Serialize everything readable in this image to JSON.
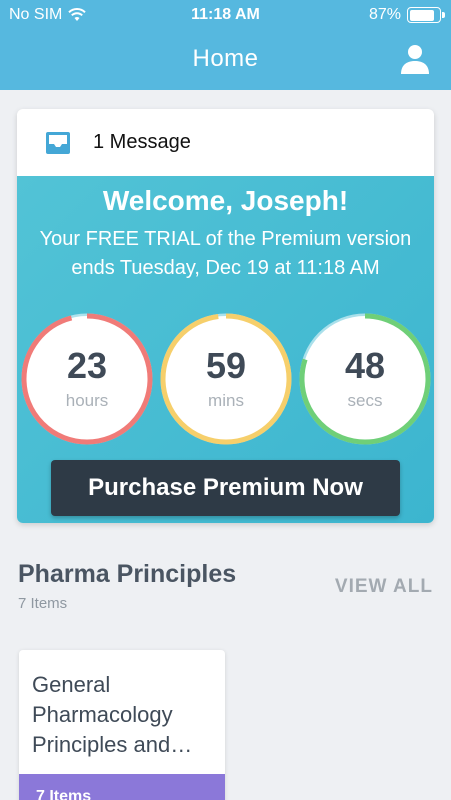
{
  "status": {
    "carrier": "No SIM",
    "time": "11:18 AM",
    "battery": "87%",
    "battery_level": 0.87
  },
  "nav": {
    "title": "Home"
  },
  "message": {
    "label": "1 Message"
  },
  "promo": {
    "welcome": "Welcome, Joseph!",
    "trial_text": "Your FREE TRIAL of the Premium version ends Tuesday, Dec 19 at 11:18 AM",
    "timers": [
      {
        "value": "23",
        "unit": "hours",
        "color": "#f07b78",
        "progress": 0.96
      },
      {
        "value": "59",
        "unit": "mins",
        "color": "#f6cf6b",
        "progress": 0.98
      },
      {
        "value": "48",
        "unit": "secs",
        "color": "#6fcf78",
        "progress": 0.8
      }
    ],
    "purchase_label": "Purchase Premium Now"
  },
  "section": {
    "title": "Pharma Principles",
    "count": "7 Items",
    "view_all": "VIEW ALL"
  },
  "tiles": [
    {
      "title": "General Pharmacology Principles and…",
      "footer": "7 Items",
      "footer_color": "#8b78d9"
    }
  ],
  "colors": {
    "header": "#56b8df",
    "promo": "#45bad2",
    "button": "#2e3a46"
  }
}
